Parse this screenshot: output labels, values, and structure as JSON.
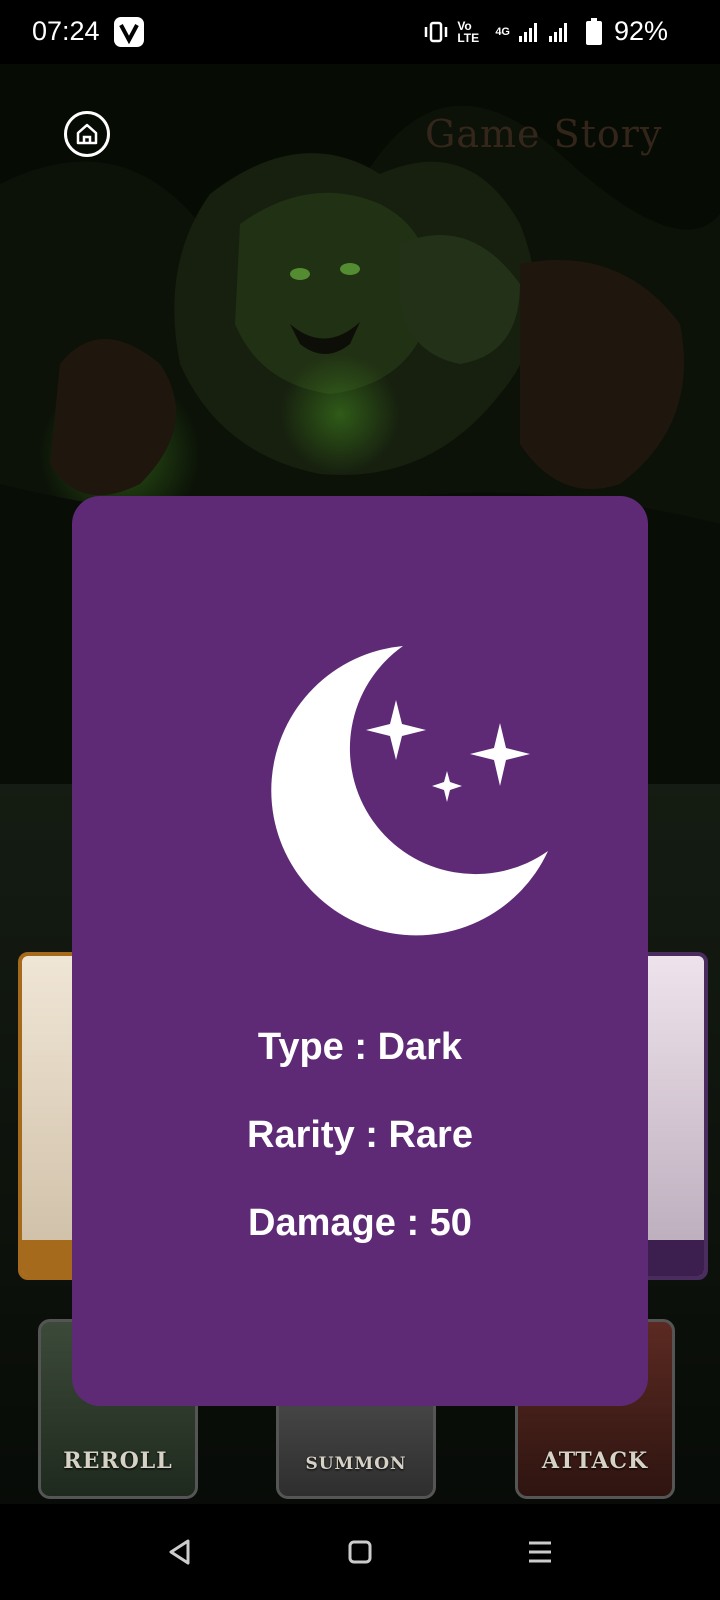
{
  "status_bar": {
    "time": "07:24",
    "battery_percent": "92%",
    "battery_level": 0.92,
    "network": "4G",
    "volte": "Vo LTE"
  },
  "header": {
    "title": "Game Story",
    "home_icon": "home-icon"
  },
  "card": {
    "icon": "crescent-moon-stars-icon",
    "background_color": "#5e2a76",
    "type_line": "Type : Dark",
    "rarity_line": "Rarity : Rare",
    "damage_line": "Damage : 50"
  },
  "actions": {
    "reroll_label": "REROLL",
    "summon_label": "SUMMON",
    "attack_label": "ATTACK"
  },
  "nav_bar": {
    "back_icon": "back-triangle-icon",
    "home_icon": "square-home-icon",
    "menu_icon": "menu-lines-icon"
  }
}
